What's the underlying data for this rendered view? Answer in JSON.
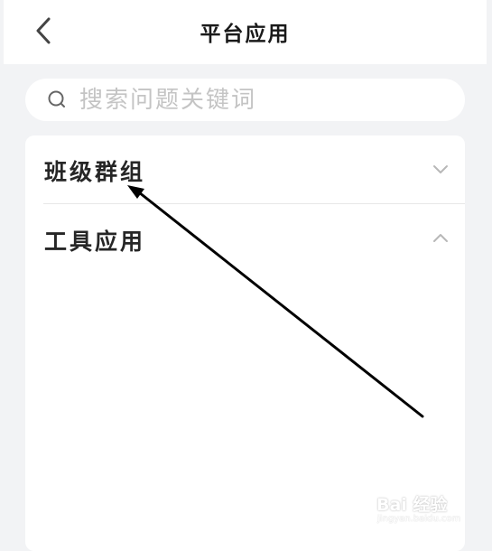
{
  "header": {
    "title": "平台应用",
    "back_icon": "chevron-left-icon"
  },
  "search": {
    "placeholder": "搜索问题关键词",
    "value": "",
    "icon": "search-icon"
  },
  "sections": [
    {
      "label": "班级群组",
      "state": "collapsed",
      "icon": "chevron-down-icon"
    },
    {
      "label": "工具应用",
      "state": "expanded",
      "icon": "chevron-up-icon"
    }
  ],
  "watermark": {
    "brand": "Bai 经验",
    "url": "jingyan.baidu.com"
  },
  "colors": {
    "background": "#f2f3f5",
    "surface": "#ffffff",
    "text": "#1a1a1a",
    "placeholder": "#c4c4c4",
    "icon": "#b8b8b8",
    "annotation_arrow": "#000000"
  }
}
